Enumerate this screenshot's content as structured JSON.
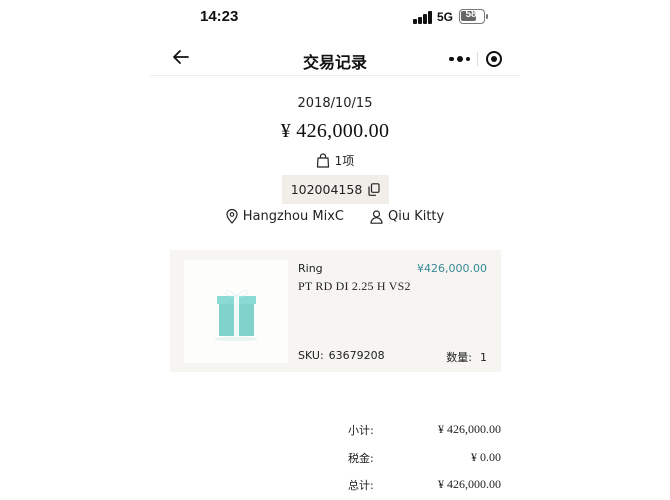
{
  "status_bar": {
    "time": "14:23",
    "network": "5G",
    "battery": "58"
  },
  "nav": {
    "title": "交易记录",
    "icons": [
      "arrow-left-icon",
      "more-dots-icon",
      "target-close-icon"
    ]
  },
  "summary": {
    "date": "2018/10/15",
    "total": "¥ 426,000.00",
    "items_count": "1项",
    "order_number": "102004158",
    "store": "Hangzhou MixC",
    "advisor": "Qiu Kitty"
  },
  "product": {
    "category": "Ring",
    "price": "¥426,000.00",
    "description": "PT RD DI 2.25 H VS2",
    "sku_label": "SKU:",
    "sku_value": "63679208",
    "qty_label": "数量:",
    "qty_value": "1",
    "colors": {
      "price": "#3a8a96",
      "gift_box": "#81d8d0"
    }
  },
  "totals": [
    {
      "label": "小计:",
      "value": "¥ 426,000.00"
    },
    {
      "label": "税金:",
      "value": "¥ 0.00"
    },
    {
      "label": "总计:",
      "value": "¥ 426,000.00"
    }
  ]
}
